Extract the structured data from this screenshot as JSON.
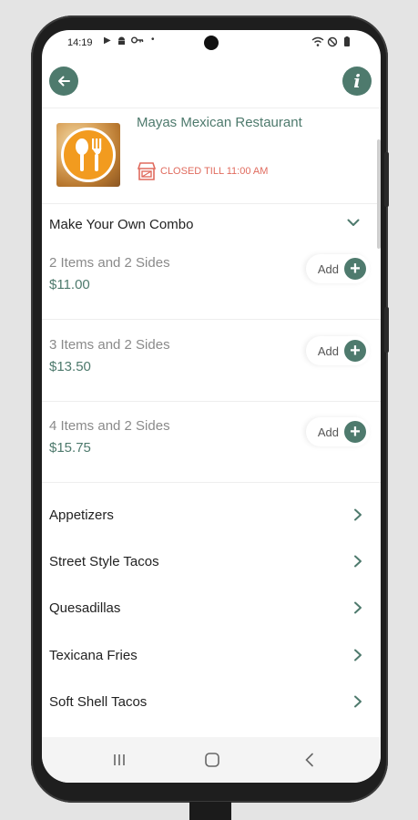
{
  "status_bar": {
    "time": "14:19",
    "left_icons": [
      "play-icon",
      "android-icon",
      "key-icon",
      "dot-icon"
    ],
    "right_icons": [
      "wifi-icon",
      "do-not-disturb-icon",
      "battery-icon"
    ]
  },
  "header": {
    "back_icon": "arrow-left-icon",
    "info_icon": "info-icon",
    "info_letter": "i"
  },
  "restaurant": {
    "name": "Mayas Mexican Restaurant",
    "status": "CLOSED TILL 11:00 AM",
    "status_icon": "store-icon",
    "logo_icon": "spoon-fork-logo",
    "brand_color": "#4e7a6d",
    "closed_color": "#e06b5e"
  },
  "combo": {
    "title": "Make Your Own Combo",
    "expanded": true,
    "items": [
      {
        "name": "2 Items and 2 Sides",
        "price": "$11.00",
        "add_label": "Add"
      },
      {
        "name": "3 Items and 2 Sides",
        "price": "$13.50",
        "add_label": "Add"
      },
      {
        "name": "4 Items and 2 Sides",
        "price": "$15.75",
        "add_label": "Add"
      }
    ]
  },
  "categories": [
    {
      "label": "Appetizers"
    },
    {
      "label": "Street Style Tacos"
    },
    {
      "label": "Quesadillas"
    },
    {
      "label": "Texicana Fries"
    },
    {
      "label": "Soft Shell Tacos"
    }
  ],
  "nav_bar": {
    "buttons": [
      "recents-icon",
      "home-icon",
      "back-icon"
    ]
  }
}
